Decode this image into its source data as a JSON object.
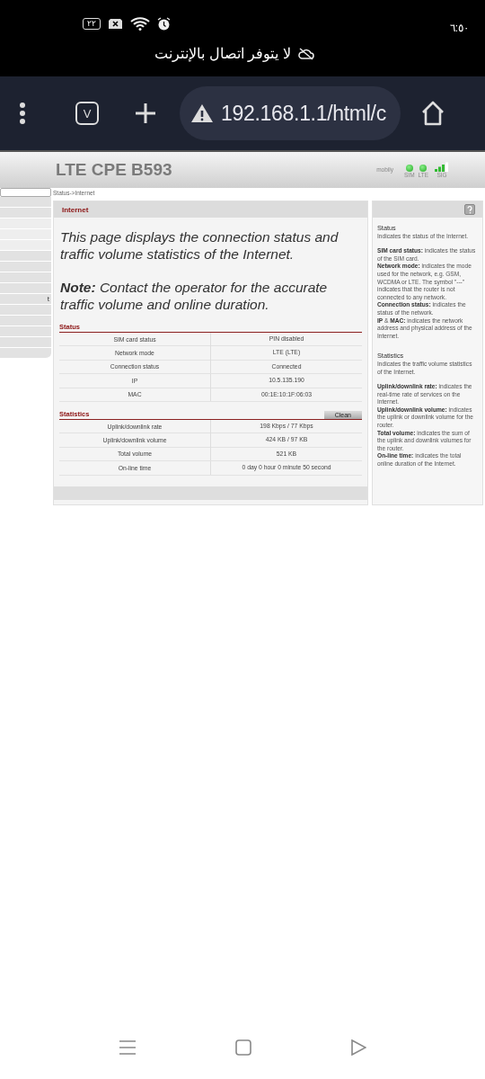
{
  "status_bar": {
    "time": "٦:٥٠",
    "battery": "٢٢"
  },
  "notification": {
    "text": "لا يتوفر اتصال بالإنترنت"
  },
  "browser": {
    "tab_count": "V",
    "url": "192.168.1.1/html/c"
  },
  "router": {
    "title": "LTE CPE B593",
    "operator": "mobily",
    "indicators": [
      {
        "label": "SIM",
        "on": true
      },
      {
        "label": "LTE",
        "on": true
      }
    ],
    "signal": {
      "label": "SIG",
      "level": 0.75
    },
    "sidebar_fragment": "t",
    "breadcrumb": "Status->Internet",
    "panel_title": "Internet",
    "intro": "This page displays the connection status and traffic volume statistics of the Internet.",
    "note": "**Note:** Contact the operator for the accurate traffic volume and online duration.",
    "sections": [
      {
        "title": "Status",
        "rows": [
          {
            "label": "SIM card status",
            "value": "PIN disabled"
          },
          {
            "label": "Network mode",
            "value": "LTE (LTE)"
          },
          {
            "label": "Connection status",
            "value": "Connected"
          },
          {
            "label": "IP",
            "value": "10.5.135.190"
          },
          {
            "label": "MAC",
            "value": "00:1E:10:1F:06:03"
          }
        ]
      },
      {
        "title": "Statistics",
        "button": "Clean",
        "rows": [
          {
            "label": "Uplink/downlink rate",
            "value": "198 Kbps / 77 Kbps"
          },
          {
            "label": "Uplink/downlink volume",
            "value": "424 KB / 97 KB"
          },
          {
            "label": "Total volume",
            "value": "521 KB"
          },
          {
            "label": "On-line time",
            "value": "0 day 0 hour 0 minute 50 second"
          }
        ]
      }
    ],
    "help": [
      {
        "title": "Status",
        "intro": "Indicates the status of the Internet.",
        "items": [
          "**SIM card status:** indicates the status of the SIM card.",
          "**Network mode:** indicates the mode used for the network, e.g. GSM, WCDMA or LTE. The symbol \"---\" indicates that the router is not connected to any network.",
          "**Connection status:** indicates the status of the network.",
          "**IP** & **MAC:** indicates the network address and physical address of the Internet."
        ]
      },
      {
        "title": "Statistics",
        "intro": "Indicates the traffic volume statistics of the Internet.",
        "items": [
          "**Uplink/downlink rate:** indicates the real-time rate of services on the Internet.",
          "**Uplink/downlink volume:** indicates the uplink or downlink volume for the router.",
          "**Total volume:** indicates the sum of the uplink and downlink volumes for the router.",
          "**On-line time:** indicates the total online duration of the Internet."
        ]
      }
    ]
  }
}
